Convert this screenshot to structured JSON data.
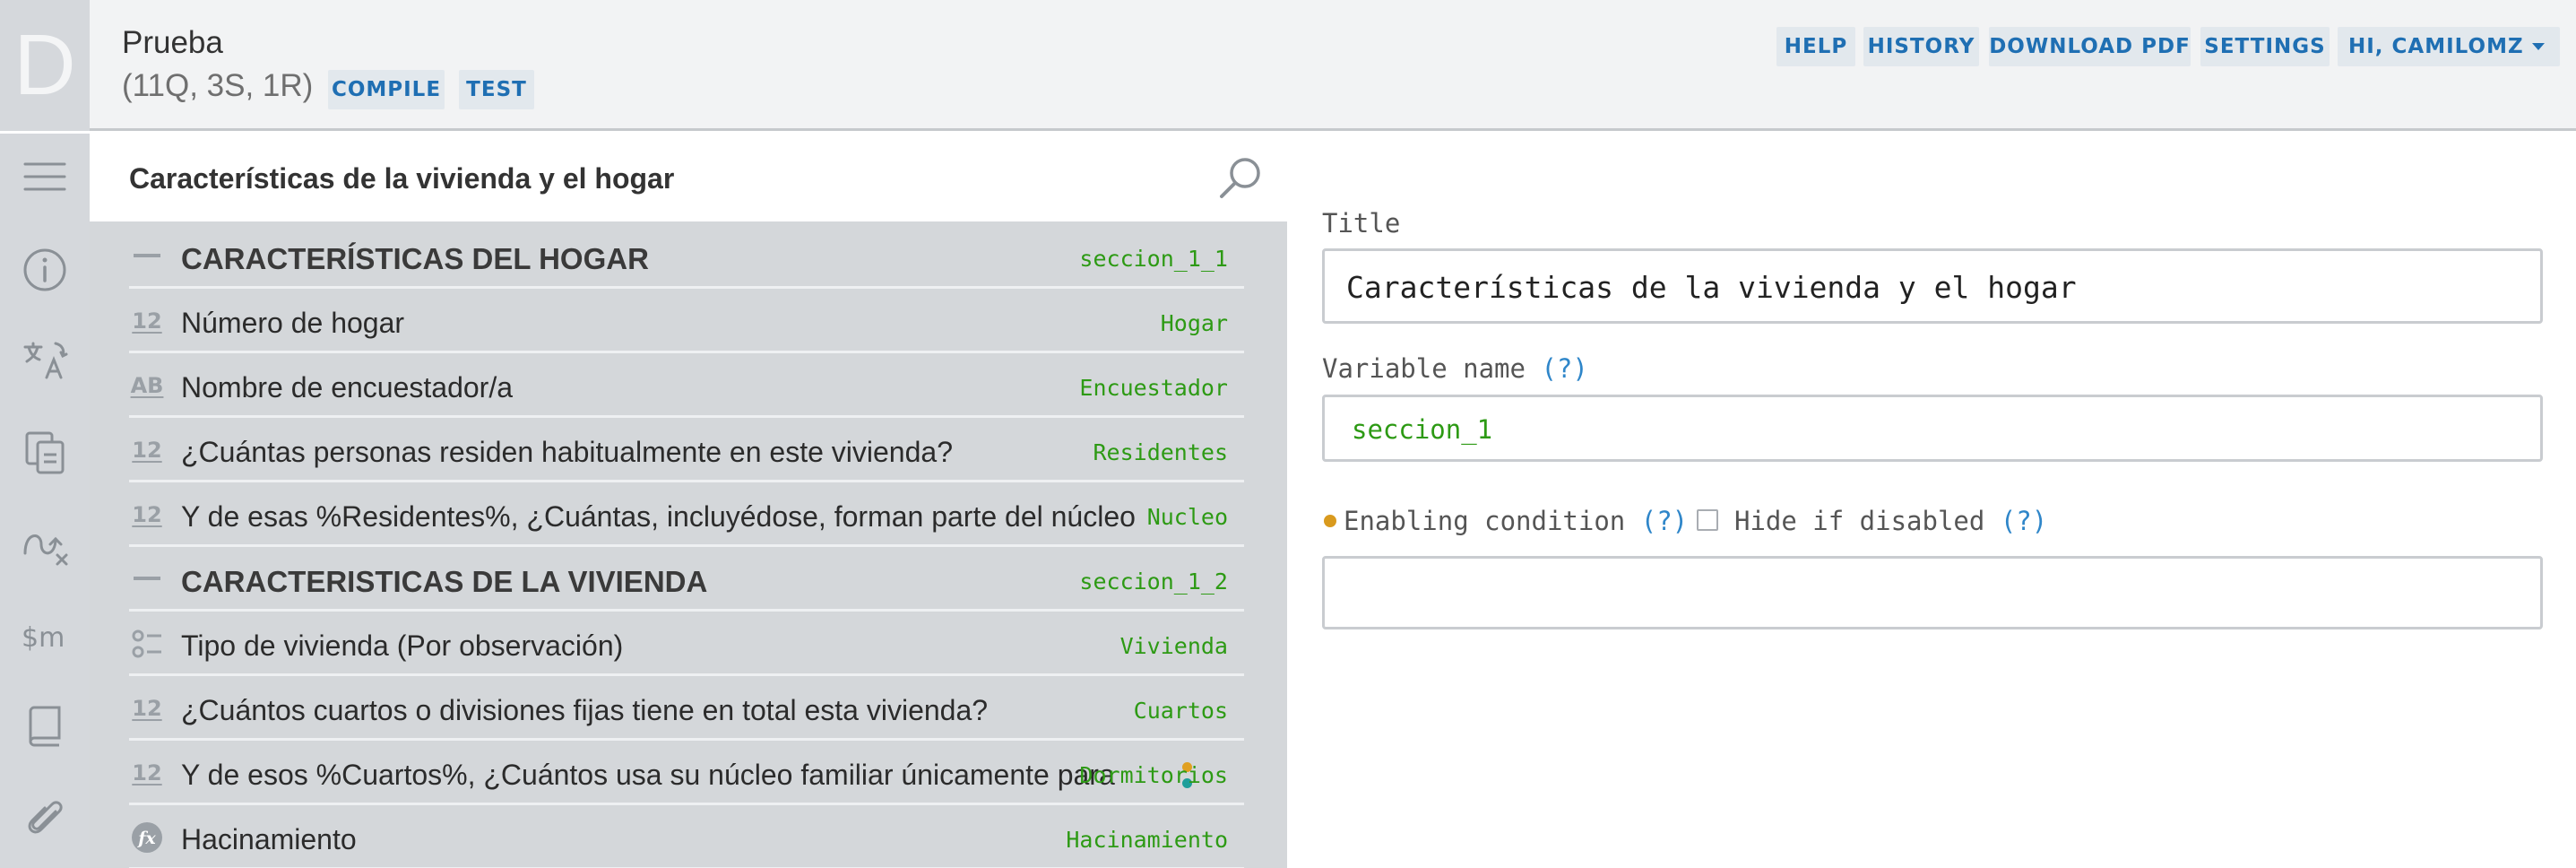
{
  "header": {
    "logo_letter": "D",
    "title": "Prueba",
    "stats": "(11Q, 3S, 1R)",
    "compile_label": "COMPILE",
    "test_label": "TEST",
    "menu": {
      "help": "HELP",
      "history": "HISTORY",
      "download_pdf": "DOWNLOAD PDF",
      "settings": "SETTINGS",
      "user": "HI, CAMILOMZ"
    }
  },
  "sidebar": {
    "icons": [
      "menu-icon",
      "info-icon",
      "translate-icon",
      "copy-icon",
      "routing-icon",
      "macros-icon",
      "book-icon",
      "attachment-icon"
    ]
  },
  "panel": {
    "section_title": "Características de la vivienda y el hogar",
    "rows": [
      {
        "type": "section",
        "label": "CARACTERÍSTICAS DEL HOGAR",
        "var": "seccion_1_1"
      },
      {
        "type": "numeric",
        "type_glyph": "12",
        "label": "Número de hogar",
        "var": "Hogar"
      },
      {
        "type": "text",
        "type_glyph": "AB",
        "label": "Nombre de encuestador/a",
        "var": "Encuestador"
      },
      {
        "type": "numeric",
        "type_glyph": "12",
        "label": "¿Cuántas personas residen habitualmente en este vivienda?",
        "var": "Residentes"
      },
      {
        "type": "numeric",
        "type_glyph": "12",
        "label": "Y de esas %Residentes%, ¿Cuántas, incluyédose, forman parte del núcleo",
        "var": "Nucleo"
      },
      {
        "type": "section",
        "label": "CARACTERISTICAS DE LA VIVIENDA",
        "var": "seccion_1_2"
      },
      {
        "type": "single-select",
        "label": "Tipo de vivienda (Por observación)",
        "var": "Vivienda"
      },
      {
        "type": "numeric",
        "type_glyph": "12",
        "label": "¿Cuántos cuartos o divisiones fijas tiene en total esta vivienda?",
        "var": "Cuartos"
      },
      {
        "type": "numeric",
        "type_glyph": "12",
        "label": "Y de esos %Cuartos%, ¿Cuántos usa su núcleo familiar únicamente para",
        "var": "Dormitorios",
        "has_indicators": true
      },
      {
        "type": "variable",
        "type_glyph": "fx",
        "label": "Hacinamiento",
        "var": "Hacinamiento"
      }
    ]
  },
  "properties": {
    "title_label": "Title",
    "title_value": "Características de la vivienda y el hogar",
    "variable_label": "Variable name",
    "variable_value": "seccion_1",
    "help_marker": "(?)",
    "enabling_label": "Enabling condition",
    "hide_label": "Hide if disabled",
    "enabling_value": ""
  },
  "colors": {
    "accent_blue": "#1f6fb3",
    "variable_green": "#2d9a14",
    "condition_dot": "#d99a1e",
    "indicator_orange": "#e0a021",
    "indicator_teal": "#1d9e9a"
  }
}
